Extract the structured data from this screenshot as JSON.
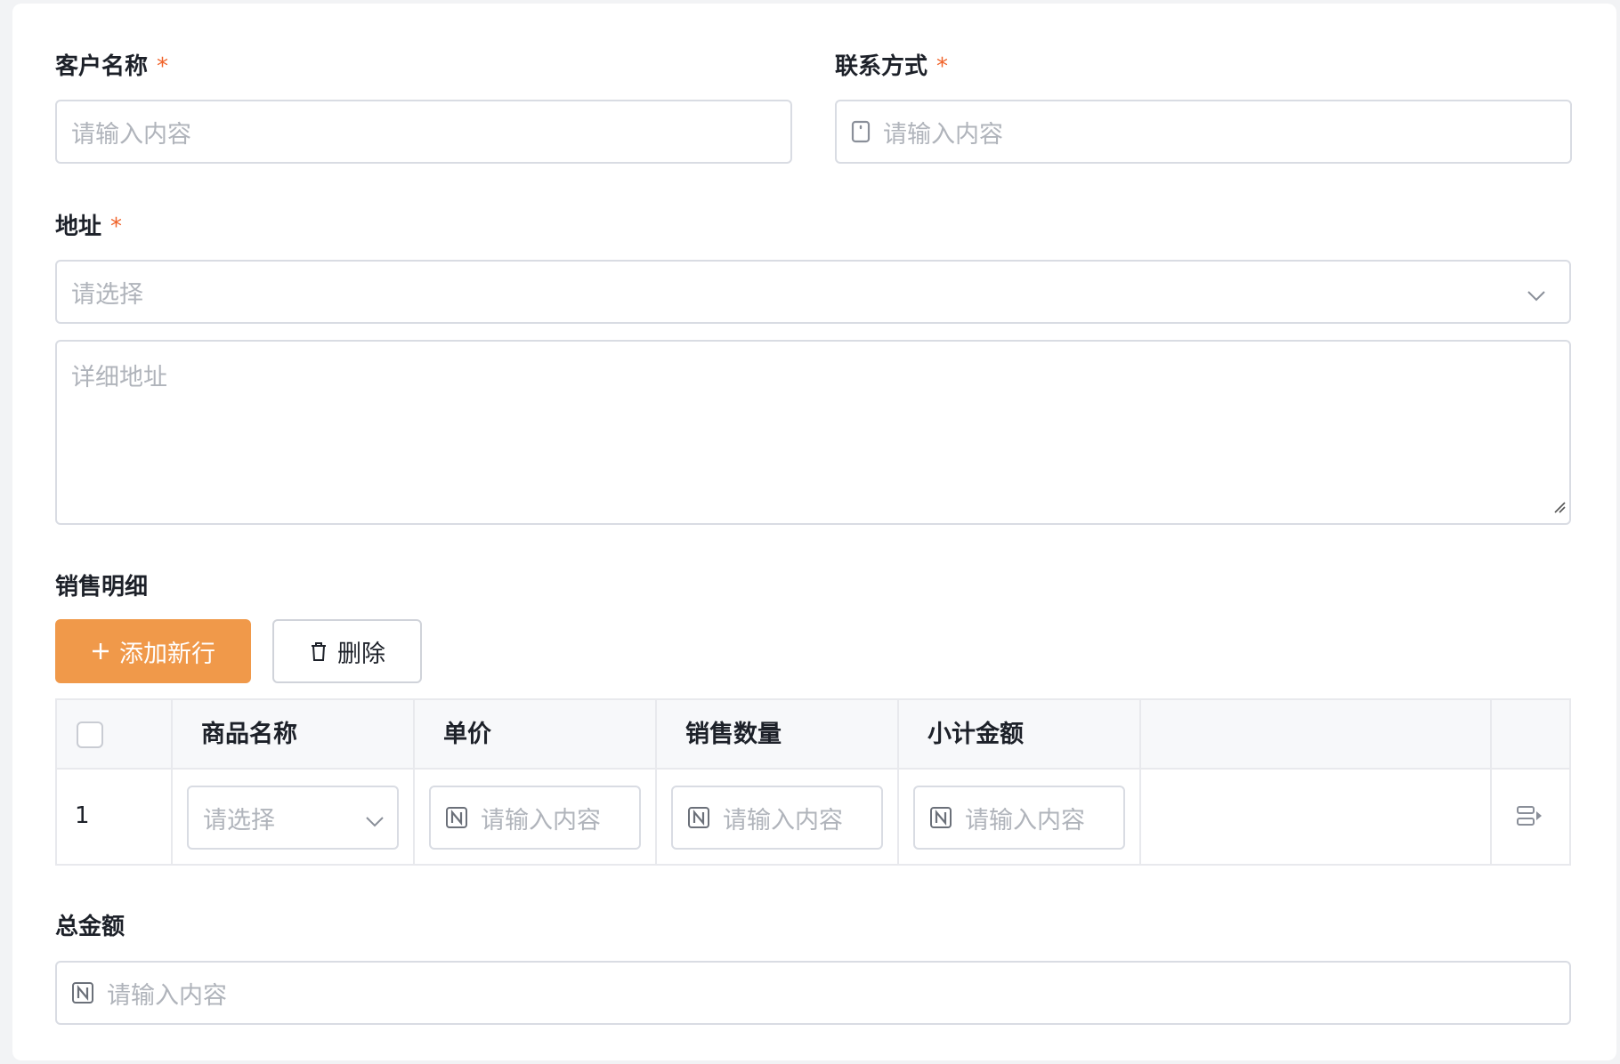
{
  "form": {
    "customer_name": {
      "label": "客户名称",
      "required_mark": "*",
      "placeholder": "请输入内容"
    },
    "contact": {
      "label": "联系方式",
      "required_mark": "*",
      "placeholder": "请输入内容",
      "icon": "phone-icon"
    },
    "address": {
      "label": "地址",
      "required_mark": "*",
      "select_placeholder": "请选择",
      "detail_placeholder": "详细地址"
    },
    "sales_detail": {
      "label": "销售明细",
      "add_button": "添加新行",
      "delete_button": "删除",
      "table": {
        "columns": [
          "商品名称",
          "单价",
          "销售数量",
          "小计金额"
        ],
        "rows": [
          {
            "index": "1",
            "product_placeholder": "请选择",
            "price_placeholder": "请输入内容",
            "quantity_placeholder": "请输入内容",
            "subtotal_placeholder": "请输入内容"
          }
        ]
      }
    },
    "total_amount": {
      "label": "总金额",
      "placeholder": "请输入内容"
    }
  },
  "colors": {
    "accent": "#f0994a",
    "required": "#f0632a",
    "border": "#d9dce3",
    "placeholder": "#b0b4bb"
  }
}
